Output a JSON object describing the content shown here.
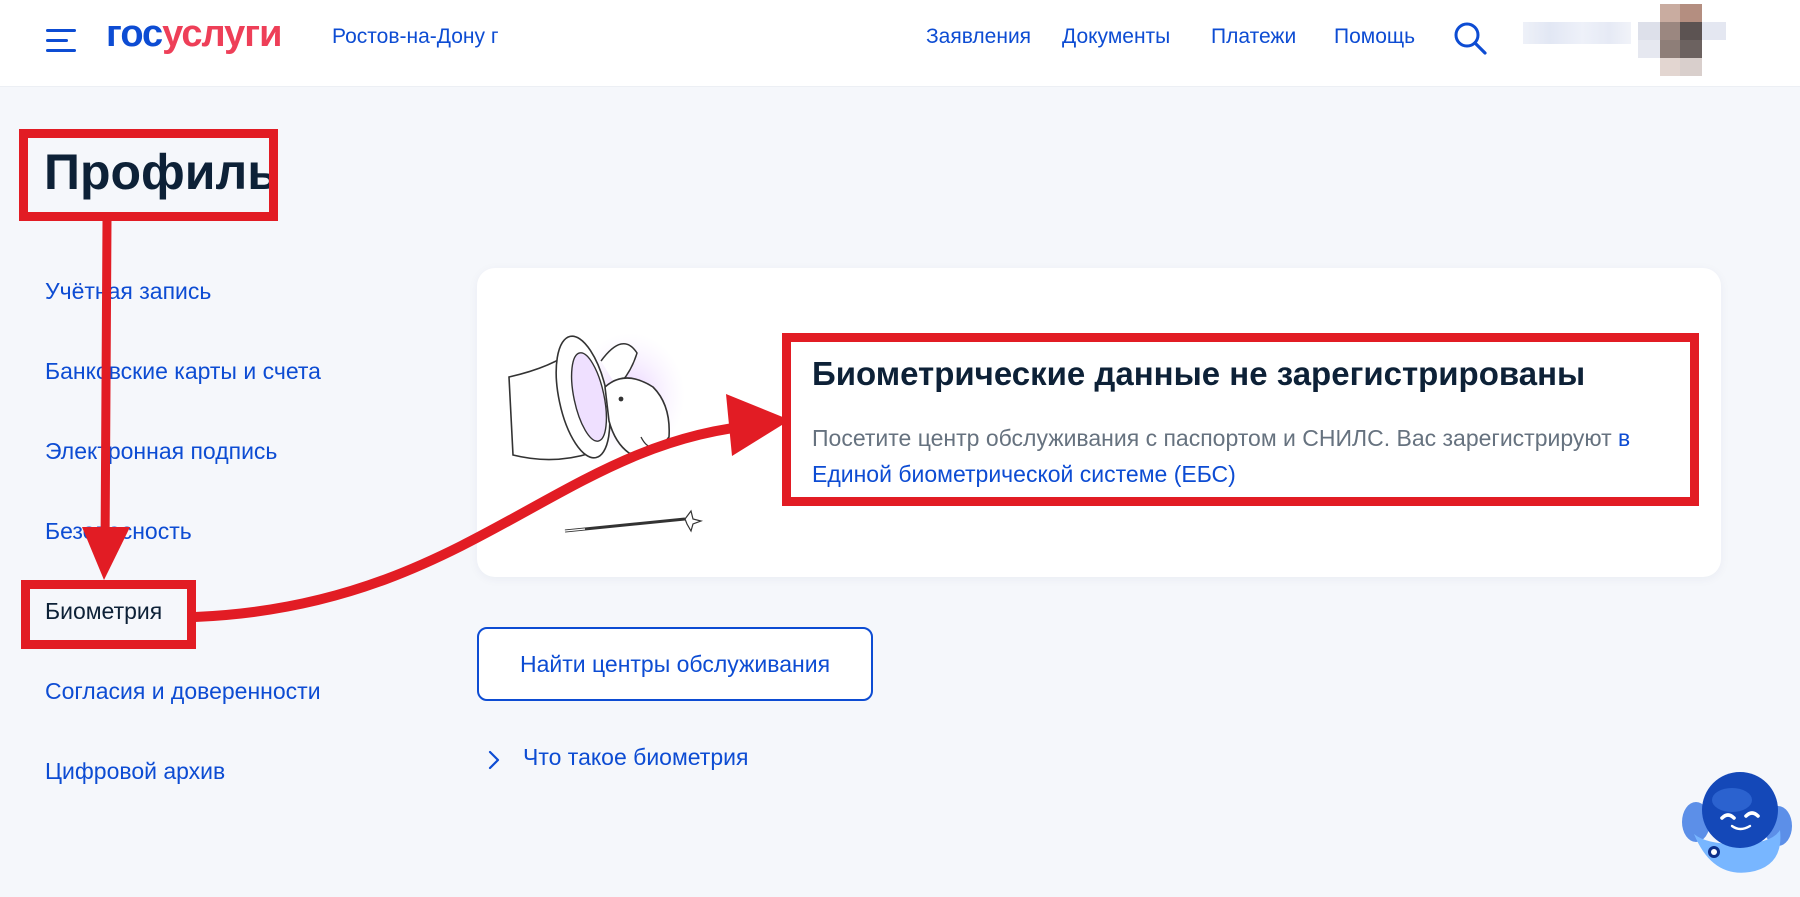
{
  "header": {
    "logo_part1": "гос",
    "logo_part2": "услуги",
    "city": "Ростов-на-Дону г",
    "nav": [
      "Заявления",
      "Документы",
      "Платежи",
      "Помощь"
    ]
  },
  "sidebar": {
    "title": "Профиль",
    "items": [
      {
        "label": "Учётная запись"
      },
      {
        "label": "Банковские карты и счета"
      },
      {
        "label": "Электронная подпись"
      },
      {
        "label": "Безопасность"
      },
      {
        "label": "Биометрия"
      },
      {
        "label": "Согласия и доверенности"
      },
      {
        "label": "Цифровой архив"
      }
    ],
    "active": "Биометрия"
  },
  "card": {
    "title": "Биометрические данные не зарегистрированы",
    "text": "Посетите центр обслуживания с паспортом и СНИЛС. Вас зарегистрируют ",
    "link": "в Единой биометрической системе (ЕБС)"
  },
  "button": {
    "label": "Найти центры обслуживания"
  },
  "faq": {
    "label": "Что такое биометрия"
  },
  "icons": {
    "menu": "hamburger-icon",
    "search": "search-icon",
    "chevron": "chevron-right-icon",
    "assistant": "robot-assistant-icon"
  },
  "colors": {
    "brand_blue": "#0d4cd3",
    "brand_red": "#ee3f58",
    "annotation_red": "#e21c24",
    "text_dark": "#0d2137",
    "text_muted": "#66727f",
    "background": "#f5f7fb"
  }
}
